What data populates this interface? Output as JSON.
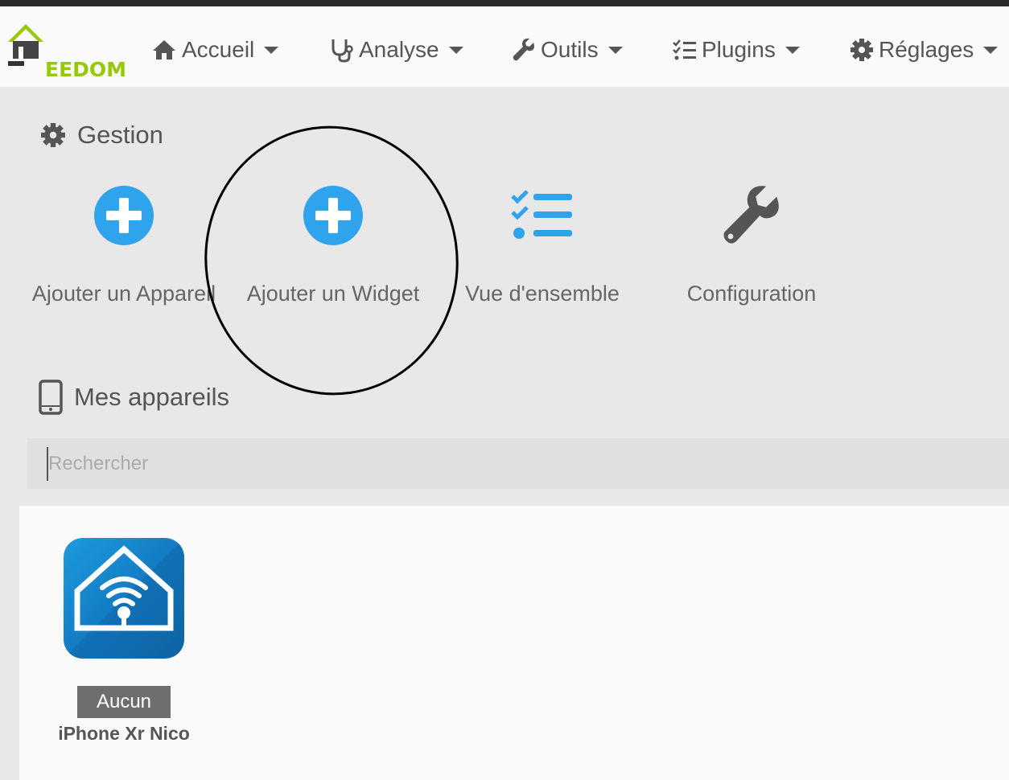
{
  "app": {
    "logo_text": "EEDOM",
    "logo_prefix": "J"
  },
  "nav": {
    "items": [
      {
        "label": "Accueil",
        "icon": "home-icon"
      },
      {
        "label": "Analyse",
        "icon": "stethoscope-icon"
      },
      {
        "label": "Outils",
        "icon": "wrench-icon"
      },
      {
        "label": "Plugins",
        "icon": "tasks-icon"
      },
      {
        "label": "Réglages",
        "icon": "gear-icon"
      }
    ]
  },
  "gestion": {
    "title": "Gestion",
    "cards": [
      {
        "label": "Ajouter un Appareil",
        "icon": "plus-circle-icon"
      },
      {
        "label": "Ajouter un Widget",
        "icon": "plus-circle-icon"
      },
      {
        "label": "Vue d'ensemble",
        "icon": "list-check-icon"
      },
      {
        "label": "Configuration",
        "icon": "wrench-icon"
      }
    ]
  },
  "devices_section": {
    "title": "Mes appareils",
    "search_placeholder": "Rechercher"
  },
  "devices": [
    {
      "name": "iPhone Xr Nico",
      "badge": "Aucun",
      "icon": "home-wifi-icon"
    }
  ],
  "colors": {
    "accent": "#2fa3ec",
    "logo_green": "#94ca02",
    "text": "#555555",
    "badge": "#6e6e6e"
  }
}
